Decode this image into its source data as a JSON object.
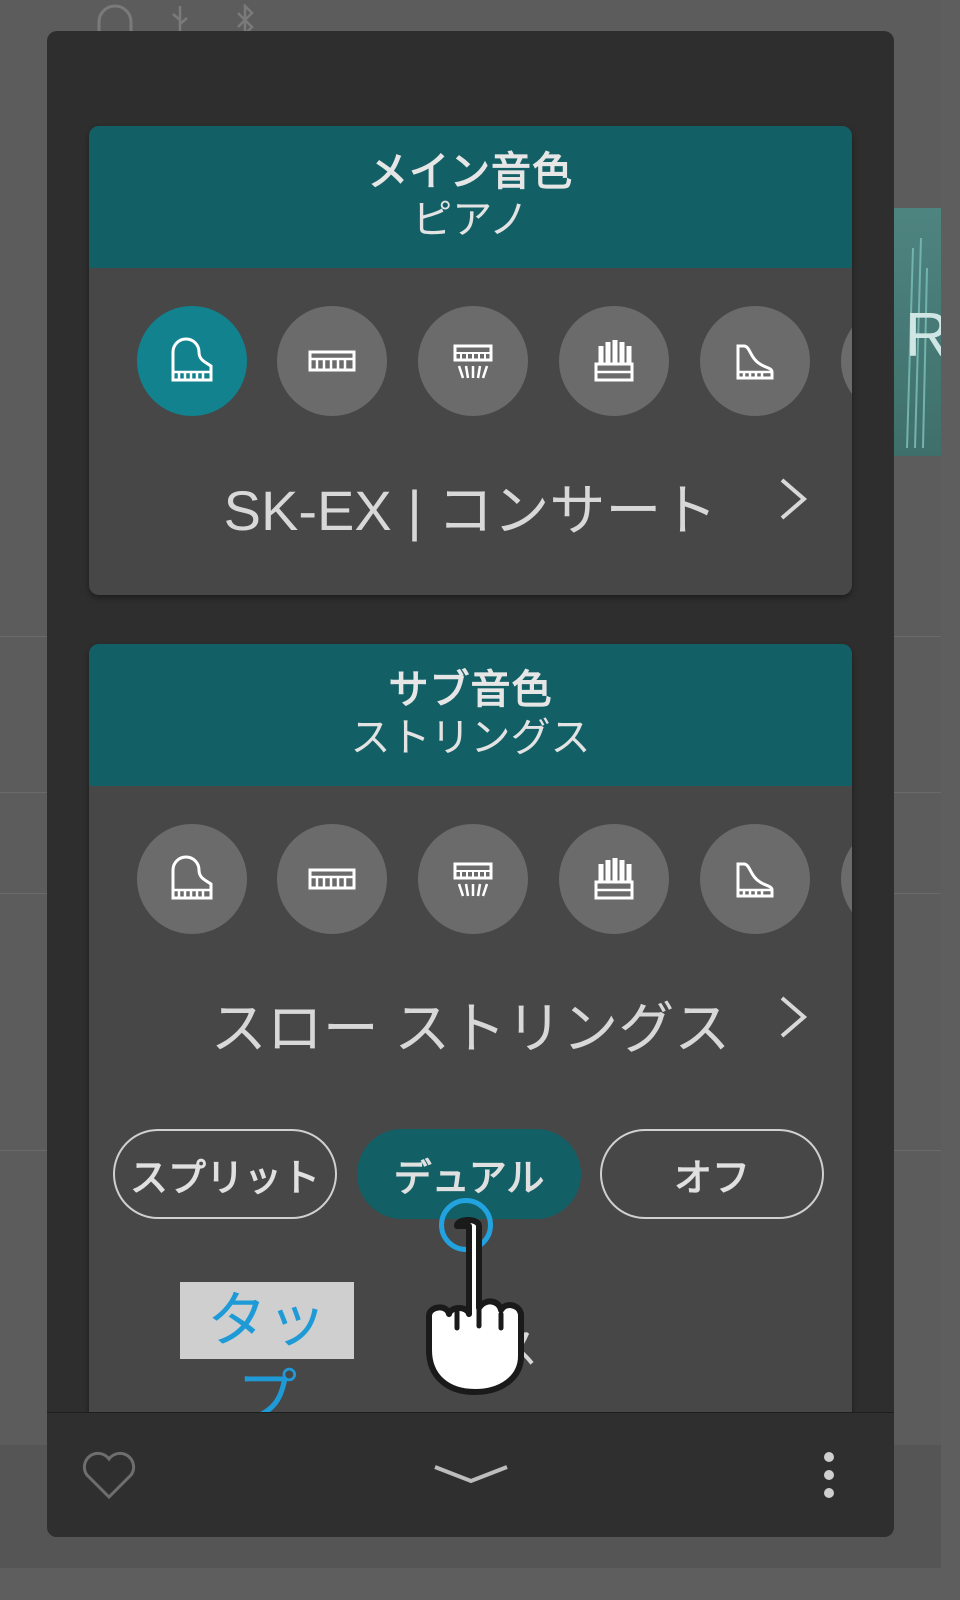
{
  "main_tone": {
    "title": "メイン音色",
    "category": "ピアノ",
    "selected_sound": "SK-EX | コンサート"
  },
  "sub_tone": {
    "title": "サブ音色",
    "category": "ストリングス",
    "selected_sound": "スロー ストリングス"
  },
  "mode_buttons": [
    {
      "label": "スプリット",
      "active": false
    },
    {
      "label": "デュアル",
      "active": true
    },
    {
      "label": "オフ",
      "active": false
    }
  ],
  "tap_hint": "タップ",
  "partial_text": "ス",
  "background": {
    "partial_letter": "R"
  },
  "colors": {
    "header_teal": "#126066",
    "active_icon": "#11828e",
    "tap_blue": "#1e9bd7"
  },
  "icons": [
    "piano-icon",
    "electric-piano-icon",
    "harpsichord-icon",
    "organ-icon",
    "upright-piano-icon",
    "more-category-icon"
  ]
}
